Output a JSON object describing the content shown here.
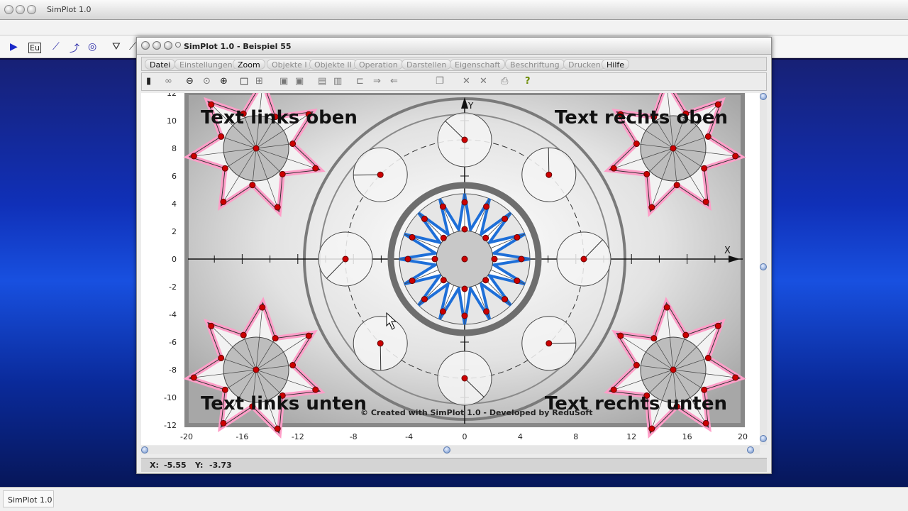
{
  "app": {
    "title": "SimPlot 1.0"
  },
  "taskbar": {
    "item": "SimPlot 1.0"
  },
  "window": {
    "title": "SimPlot 1.0 - Beispiel 55"
  },
  "menu": [
    {
      "label": "Datei",
      "enabled": true
    },
    {
      "label": "Einstellungen",
      "enabled": false
    },
    {
      "label": "Zoom",
      "enabled": true
    },
    {
      "label": "Objekte I",
      "enabled": false
    },
    {
      "label": "Objekte II",
      "enabled": false
    },
    {
      "label": "Operation",
      "enabled": false
    },
    {
      "label": "Darstellen",
      "enabled": false
    },
    {
      "label": "Eigenschaft",
      "enabled": false
    },
    {
      "label": "Beschriftung",
      "enabled": false
    },
    {
      "label": "Drucken",
      "enabled": false
    },
    {
      "label": "Hilfe",
      "enabled": true
    }
  ],
  "plot": {
    "texts": {
      "top_left": "Text links oben",
      "top_right": "Text rechts oben",
      "bottom_left": "Text links unten",
      "bottom_right": "Text rechts unten",
      "credit": "© Created with SimPlot 1.0 - Developed by ReduSoft"
    },
    "axis_label_x": "X",
    "axis_label_y": "Y",
    "x_ticks": [
      "-20",
      "-16",
      "-12",
      "-8",
      "-4",
      "0",
      "4",
      "8",
      "12",
      "16",
      "20"
    ],
    "y_ticks": [
      "12",
      "10",
      "8",
      "6",
      "4",
      "2",
      "0",
      "-2",
      "-4",
      "-6",
      "-8",
      "-10",
      "-12"
    ],
    "xlim": [
      -20,
      20
    ],
    "ylim": [
      -12,
      12
    ],
    "colors": {
      "star_outline": "#ff9ec8",
      "center_star": "#1e6fd8",
      "point": "#cc0000"
    }
  },
  "coords": {
    "x_label": "X:",
    "x_value": "-5.55",
    "y_label": "Y:",
    "y_value": "-3.73"
  }
}
